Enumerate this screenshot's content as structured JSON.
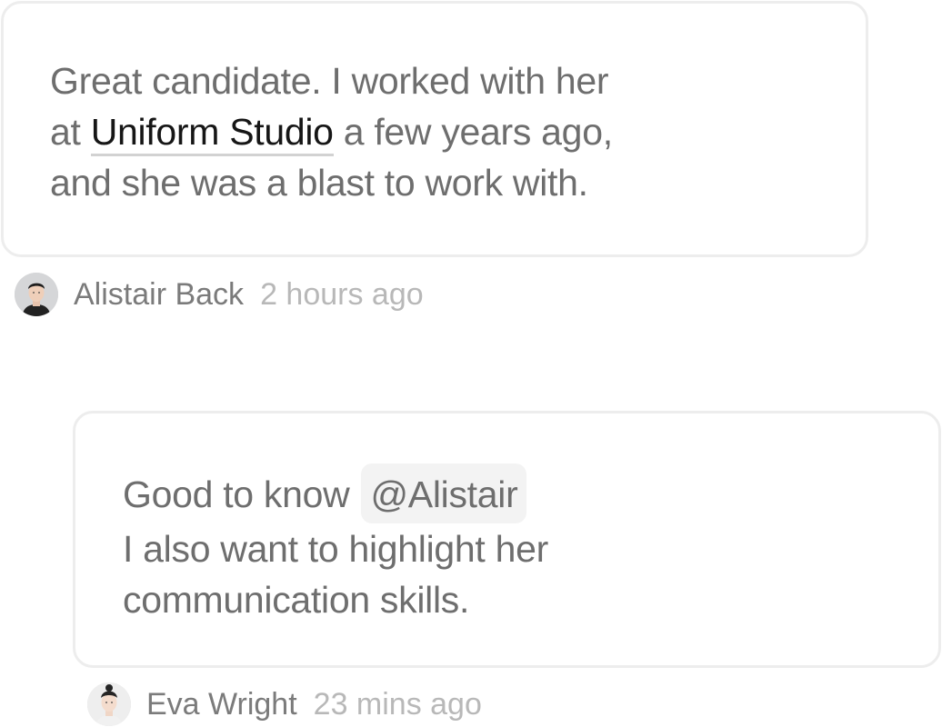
{
  "comments": [
    {
      "text": {
        "line1": "Great candidate. I worked with her",
        "line2_prefix": "at ",
        "link": "Uniform Studio",
        "line2_suffix": " a few years ago,",
        "line3": "and she was a blast to work with."
      },
      "author": "Alistair Back",
      "time": "2 hours ago",
      "avatar_icon": "avatar-man-icon"
    },
    {
      "text": {
        "line1_prefix": "Good to know ",
        "mention": "@Alistair",
        "line2": "I also want to highlight her",
        "line3": "communication skills."
      },
      "author": "Eva Wright",
      "time": "23 mins ago",
      "avatar_icon": "avatar-woman-icon"
    }
  ],
  "colors": {
    "border": "#ededed",
    "body_text": "#6e6e6e",
    "link_text": "#161616",
    "mention_bg": "#f3f3f3",
    "author_text": "#7b7b7b",
    "time_text": "#b8b8b8"
  }
}
